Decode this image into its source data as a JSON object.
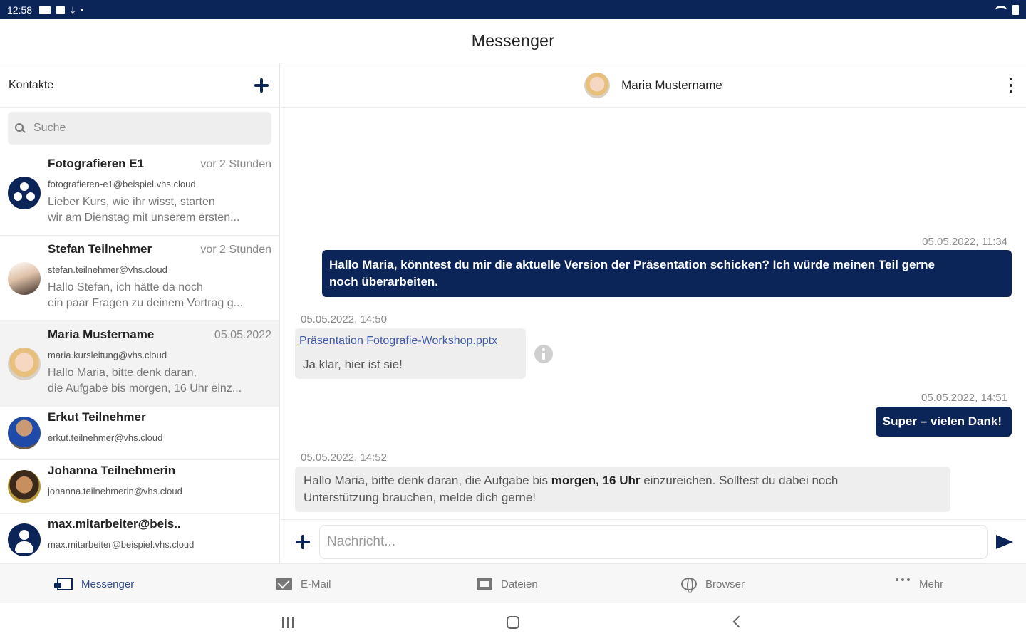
{
  "status_bar": {
    "time": "12:58"
  },
  "app": {
    "title": "Messenger"
  },
  "contacts_pane": {
    "title": "Kontakte",
    "search_placeholder": "Suche",
    "contacts": [
      {
        "name": "Fotografieren E1",
        "time": "vor 2 Stunden",
        "email": "fotografieren-e1@beispiel.vhs.cloud",
        "preview1": "Lieber Kurs,  wie ihr wisst, starten",
        "preview2": "wir am Dienstag mit unserem ersten..."
      },
      {
        "name": "Stefan Teilnehmer",
        "time": "vor 2 Stunden",
        "email": "stefan.teilnehmer@vhs.cloud",
        "preview1": "Hallo Stefan,  ich hätte da noch",
        "preview2": "ein paar Fragen zu deinem Vortrag g..."
      },
      {
        "name": "Maria Mustername",
        "time": "05.05.2022",
        "email": "maria.kursleitung@vhs.cloud",
        "preview1": "Hallo Maria, bitte denk daran,",
        "preview2": "die Aufgabe bis morgen, 16 Uhr einz..."
      },
      {
        "name": "Erkut Teilnehmer",
        "time": "",
        "email": "erkut.teilnehmer@vhs.cloud"
      },
      {
        "name": "Johanna Teilnehmerin",
        "time": "",
        "email": "johanna.teilnehmerin@vhs.cloud"
      },
      {
        "name": "max.mitarbeiter@beis..",
        "time": "",
        "email": "max.mitarbeiter@beispiel.vhs.cloud"
      }
    ]
  },
  "chat": {
    "partner_name": "Maria Mustername",
    "messages": [
      {
        "timestamp": "05.05.2022, 11:34",
        "line1": "Hallo Maria, könntest du mir die aktuelle Version der Präsentation schicken? Ich würde meinen Teil gerne",
        "line2": "noch überarbeiten."
      },
      {
        "timestamp": "05.05.2022, 14:50",
        "attachment": "Präsentation Fotografie-Workshop.pptx",
        "text": "Ja klar, hier ist sie!"
      },
      {
        "timestamp": "05.05.2022, 14:51",
        "text": "Super – vielen Dank!"
      },
      {
        "timestamp": "05.05.2022, 14:52",
        "line1_a": "Hallo Maria, bitte denk daran, die Aufgabe bis ",
        "line1_b": "morgen, 16 Uhr",
        "line1_c": " einzureichen. Solltest du dabei noch",
        "line2": "Unterstützung brauchen, melde dich gerne!"
      }
    ],
    "composer_placeholder": "Nachricht..."
  },
  "bottom_nav": {
    "items": [
      {
        "label": "Messenger",
        "icon": "messenger-icon",
        "active": true
      },
      {
        "label": "E-Mail",
        "icon": "mail-icon"
      },
      {
        "label": "Dateien",
        "icon": "files-icon"
      },
      {
        "label": "Browser",
        "icon": "browser-icon"
      },
      {
        "label": "Mehr",
        "icon": "more-icon"
      }
    ]
  },
  "colors": {
    "brand": "#0c2559",
    "incoming_bubble": "#eeeeee",
    "link": "#3f5aa6"
  }
}
